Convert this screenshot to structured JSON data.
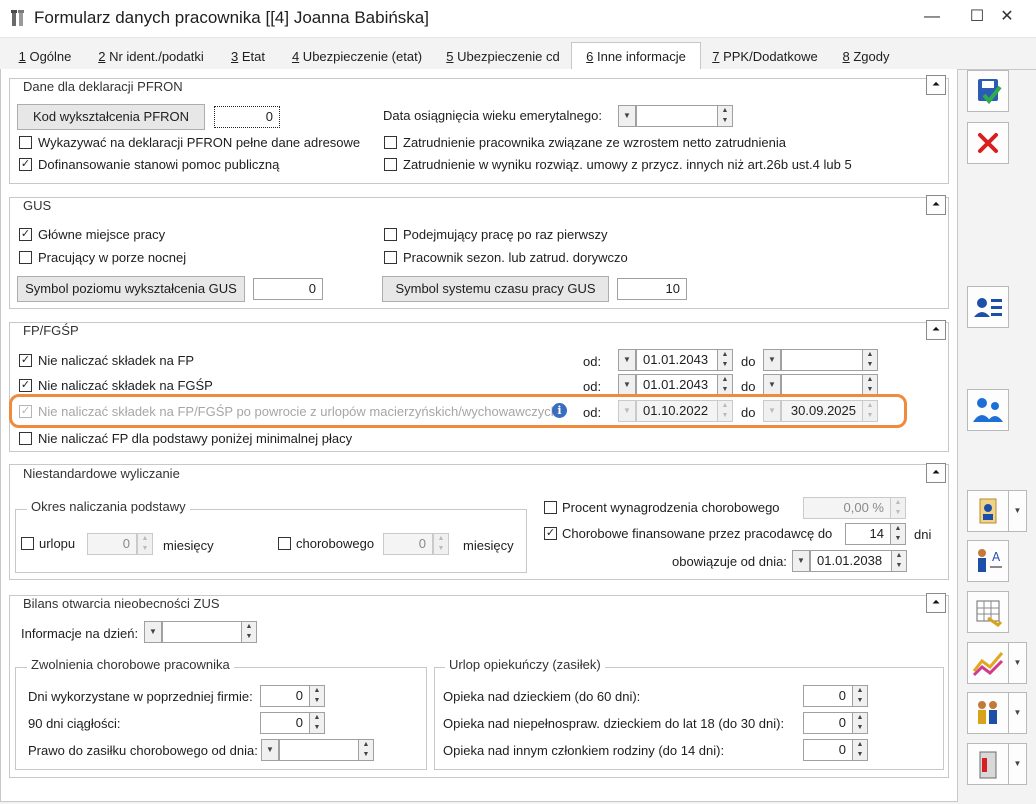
{
  "window": {
    "title": "Formularz danych pracownika [[4] Joanna Babińska]",
    "minimize": "—",
    "maximize": "☐",
    "close": "✕"
  },
  "tabs": [
    {
      "num": "1",
      "label": " Ogólne"
    },
    {
      "num": "2",
      "label": " Nr ident./podatki"
    },
    {
      "num": "3",
      "label": " Etat"
    },
    {
      "num": "4",
      "label": " Ubezpieczenie (etat)"
    },
    {
      "num": "5",
      "label": " Ubezpieczenie cd"
    },
    {
      "num": "6",
      "label": " Inne informacje"
    },
    {
      "num": "7",
      "label": " PPK/Dodatkowe"
    },
    {
      "num": "8",
      "label": " Zgody"
    }
  ],
  "pfron": {
    "title": "Dane dla deklaracji PFRON",
    "kod_button": "Kod wykształcenia PFRON",
    "kod_value": "0",
    "data_label": "Data osiągnięcia wieku emerytalnego:",
    "data_value": "",
    "cb1": "Wykazywać na deklaracji PFRON pełne dane adresowe",
    "cb2": "Dofinansowanie stanowi pomoc publiczną",
    "cb3": "Zatrudnienie pracownika związane ze wzrostem netto zatrudnienia",
    "cb4": "Zatrudnienie w wyniku rozwiąz. umowy z przycz. innych niż art.26b ust.4 lub 5"
  },
  "gus": {
    "title": "GUS",
    "cb1": "Główne miejsce pracy",
    "cb2": "Pracujący w porze nocnej",
    "cb3": "Podejmujący pracę po raz pierwszy",
    "cb4": "Pracownik sezon. lub zatrud. dorywczo",
    "symbol_wyk_button": "Symbol poziomu wykształcenia GUS",
    "symbol_wyk_value": "0",
    "symbol_czas_button": "Symbol systemu czasu pracy GUS",
    "symbol_czas_value": "10"
  },
  "fp": {
    "title": "FP/FGŚP",
    "row1": "Nie naliczać składek na FP",
    "row2": "Nie naliczać składek na FGŚP",
    "row3": "Nie naliczać składek na FP/FGŚP po powrocie z urlopów macierzyńskich/wychowawczych",
    "row4": "Nie naliczać FP dla podstawy poniżej minimalnej płacy",
    "od": "od:",
    "do": "do",
    "r1_od": "01.01.2043",
    "r1_do": "",
    "r2_od": "01.01.2043",
    "r2_do": "",
    "r3_od": "01.10.2022",
    "r3_do": "30.09.2025",
    "info": "i"
  },
  "niestd": {
    "title": "Niestandardowe wyliczanie",
    "okres_title": "Okres naliczania podstawy",
    "urlopu": "urlopu",
    "urlopu_val": "0",
    "miesiecy1": "miesięcy",
    "chorobowego": "chorobowego",
    "chor_val": "0",
    "miesiecy2": "miesięcy",
    "procent_label": "Procent wynagrodzenia chorobowego",
    "procent_val": "0,00 %",
    "chor_fin_label": "Chorobowe finansowane przez pracodawcę do",
    "chor_fin_val": "14",
    "dni": "dni",
    "obow_label": "obowiązuje od dnia:",
    "obow_val": "01.01.2038"
  },
  "bilans": {
    "title": "Bilans otwarcia nieobecności ZUS",
    "info_label": "Informacje na dzień:",
    "info_val": "",
    "zwol_title": "Zwolnienia chorobowe pracownika",
    "dni_wyk": "Dni wykorzystane w poprzedniej firmie:",
    "dni_wyk_val": "0",
    "dni_90": "90 dni ciągłości:",
    "dni_90_val": "0",
    "prawo": "Prawo do zasiłku chorobowego od dnia:",
    "prawo_val": "",
    "urlop_title": "Urlop opiekuńczy (zasiłek)",
    "op1": "Opieka nad dzieckiem (do 60 dni):",
    "op1_val": "0",
    "op2": "Opieka nad niepełnospraw. dzieckiem do lat 18 (do 30 dni):",
    "op2_val": "0",
    "op3": "Opieka nad innym członkiem rodziny (do 14 dni):",
    "op3_val": "0"
  }
}
